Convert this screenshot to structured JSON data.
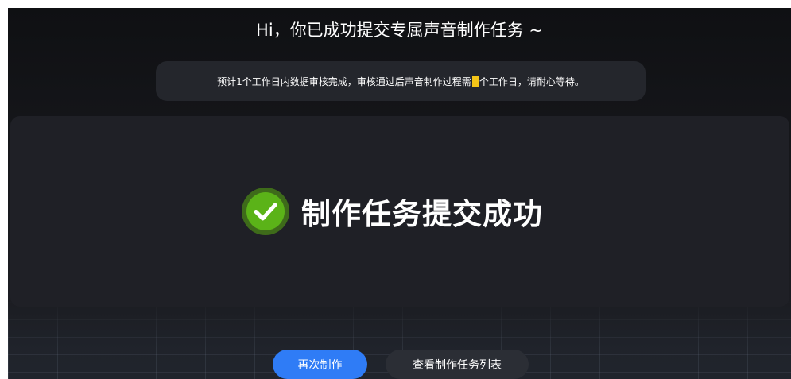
{
  "header": {
    "title": "Hi，你已成功提交专属声音制作任务 ~"
  },
  "notice": {
    "text_before": "预计1个工作日内数据审核完成，审核通过后声音制作过程需",
    "text_after": "个工作日，请耐心等待。",
    "highlight_color": "#f5c518"
  },
  "result": {
    "title": "制作任务提交成功",
    "icon": "check-circle-icon",
    "icon_color": "#5bb318"
  },
  "actions": {
    "primary_label": "再次制作",
    "secondary_label": "查看制作任务列表",
    "primary_color": "#2f7cf6"
  }
}
